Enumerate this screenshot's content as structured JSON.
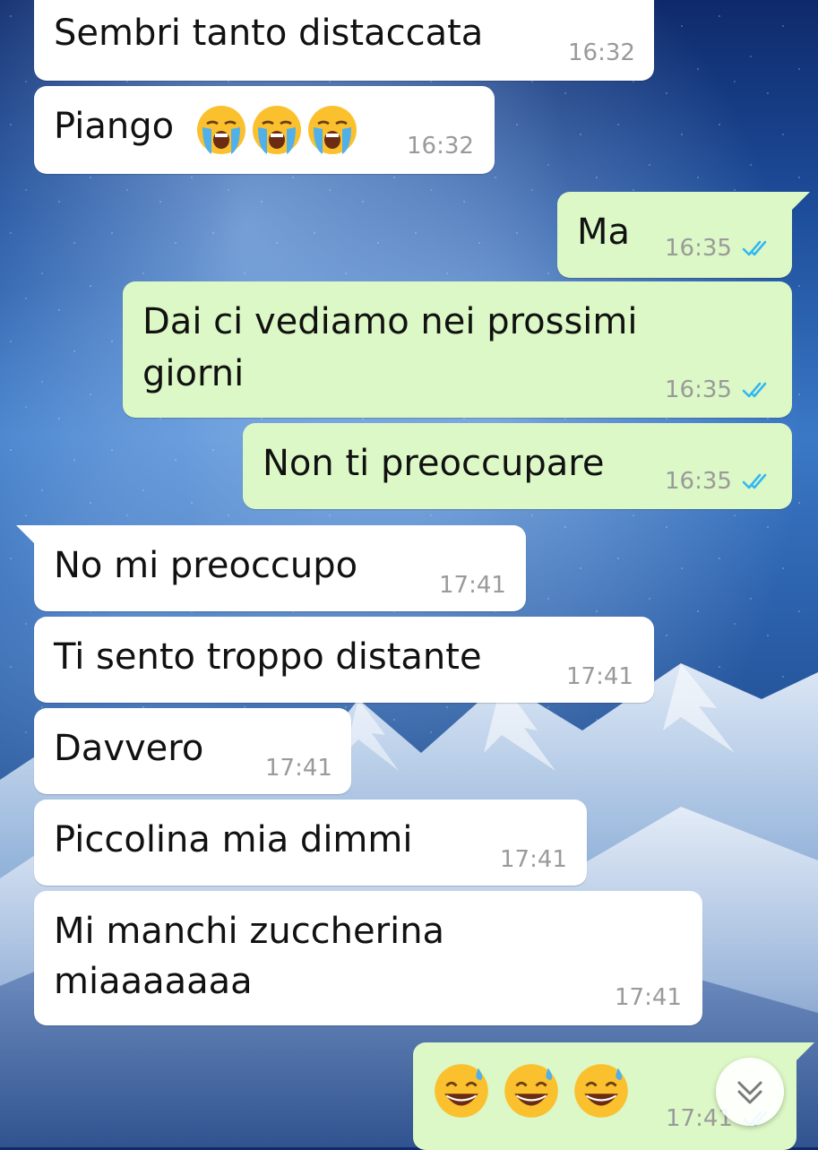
{
  "chat": {
    "messages": [
      {
        "id": "m1",
        "direction": "incoming",
        "text": "Sembri tanto distaccata",
        "time": "16:32"
      },
      {
        "id": "m2",
        "direction": "incoming",
        "text": "Piango",
        "emojis": [
          "loudly-crying-face",
          "loudly-crying-face",
          "loudly-crying-face"
        ],
        "time": "16:32"
      },
      {
        "id": "m3",
        "direction": "outgoing",
        "text": "Ma",
        "time": "16:35",
        "status": "read"
      },
      {
        "id": "m4",
        "direction": "outgoing",
        "lines": [
          "Dai ci vediamo nei prossimi",
          "giorni"
        ],
        "time": "16:35",
        "status": "read"
      },
      {
        "id": "m5",
        "direction": "outgoing",
        "text": "Non ti preoccupare",
        "time": "16:35",
        "status": "read"
      },
      {
        "id": "m6",
        "direction": "incoming",
        "text": "No mi preoccupo",
        "time": "17:41"
      },
      {
        "id": "m7",
        "direction": "incoming",
        "text": "Ti sento troppo distante",
        "time": "17:41"
      },
      {
        "id": "m8",
        "direction": "incoming",
        "text": "Davvero",
        "time": "17:41"
      },
      {
        "id": "m9",
        "direction": "incoming",
        "text": "Piccolina mia dimmi",
        "time": "17:41"
      },
      {
        "id": "m10",
        "direction": "incoming",
        "lines": [
          "Mi manchi zuccherina",
          "miaaaaaaa"
        ],
        "time": "17:41"
      },
      {
        "id": "m11",
        "direction": "outgoing",
        "emojis": [
          "grinning-face-with-sweat",
          "grinning-face-with-sweat",
          "grinning-face-with-sweat"
        ],
        "time": "17:41",
        "status": "read"
      }
    ]
  },
  "colors": {
    "incoming_bubble": "#ffffff",
    "outgoing_bubble": "#dcf8c6",
    "read_ticks": "#34b7f1",
    "timestamp": "#9a9a9a"
  },
  "icons": {
    "read_receipt": "double-check-icon",
    "scroll_down": "chevron-double-down-icon"
  }
}
